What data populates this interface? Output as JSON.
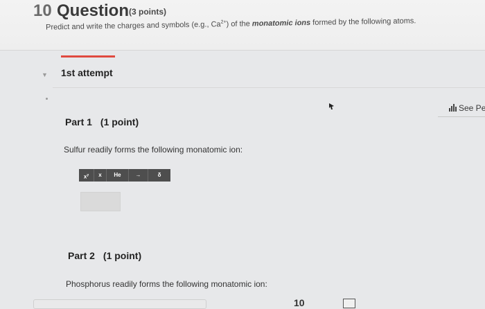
{
  "question": {
    "number": "10",
    "title": "Question",
    "points": "(3 points)",
    "instructions_pre": "Predict and write the charges and symbols (e.g., Ca",
    "instructions_sup": "2+",
    "instructions_mid": ") of the ",
    "instructions_emph": "monatomic ions",
    "instructions_post": " formed by the following atoms."
  },
  "attempt": {
    "label": "1st attempt"
  },
  "see_periodic": {
    "label": "See Pe"
  },
  "parts": [
    {
      "title": "Part 1",
      "points": "(1 point)",
      "prompt": "Sulfur readily forms the following monatomic ion:"
    },
    {
      "title": "Part 2",
      "points": "(1 point)",
      "prompt": "Phosphorus readily forms the following monatomic ion:"
    }
  ],
  "toolbar": {
    "buttons": [
      {
        "label": "x",
        "sup": "y",
        "icon": "superscript-icon"
      },
      {
        "label": "x",
        "icon": "subscript-icon"
      },
      {
        "label": "He",
        "icon": "element-icon"
      },
      {
        "label": "→",
        "icon": "arrow-icon"
      },
      {
        "label": "δ",
        "icon": "delta-icon"
      }
    ]
  },
  "bottom": {
    "number": "10"
  }
}
